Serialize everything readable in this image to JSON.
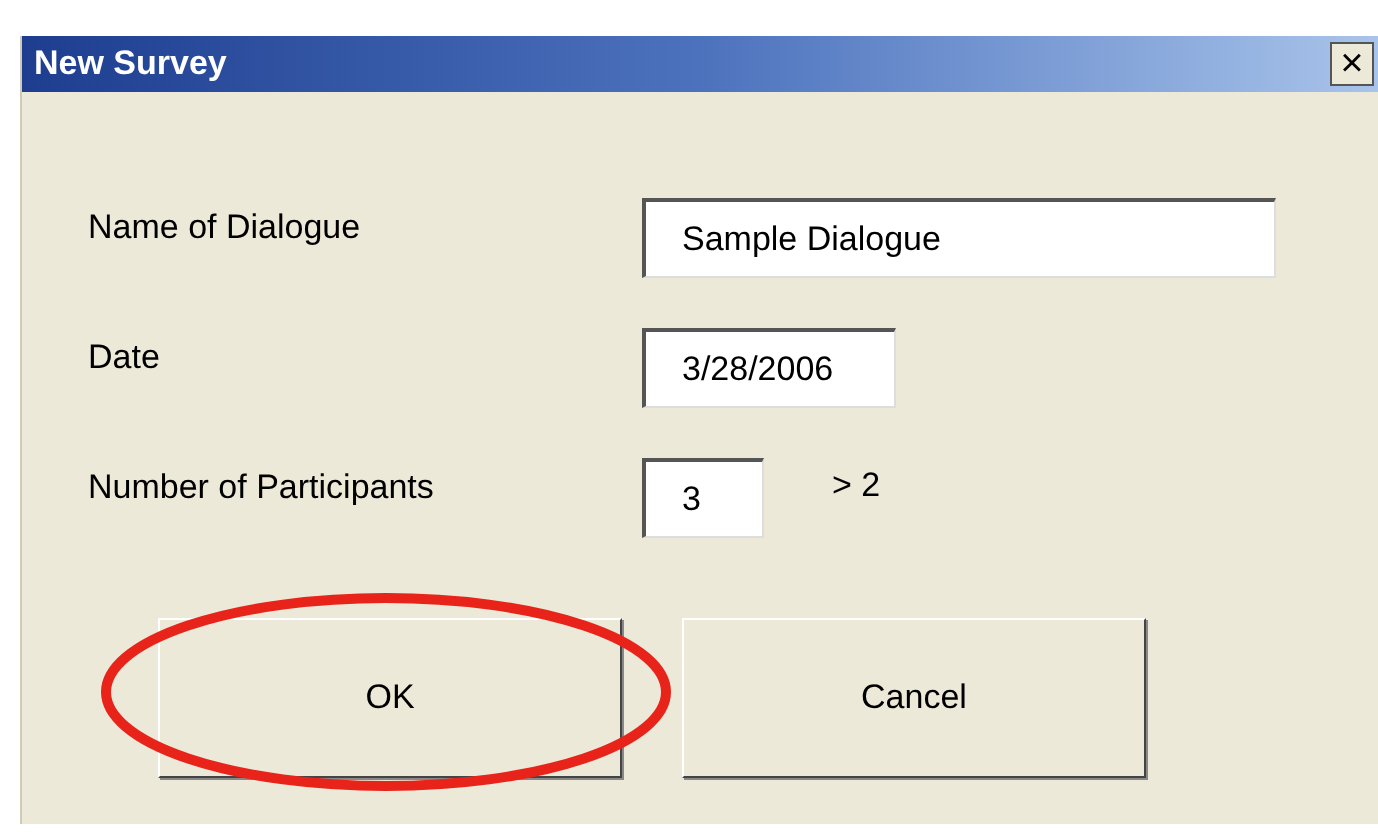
{
  "window": {
    "title": "New Survey",
    "close": "×"
  },
  "fields": [
    {
      "label": "Name of Dialogue",
      "value": "Sample Dialogue"
    },
    {
      "label": "Date",
      "value": "3/28/2006"
    },
    {
      "label": "Number of Participants",
      "value": "3",
      "hint": "> 2"
    }
  ],
  "buttons": [
    {
      "label": "OK",
      "circled": true
    },
    {
      "label": "Cancel",
      "circled": false
    }
  ]
}
